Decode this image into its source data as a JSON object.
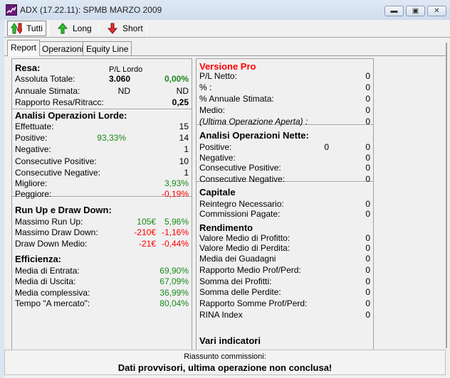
{
  "window": {
    "title": "ADX (17.22.11): SPMB MARZO 2009",
    "minimize": "minimize",
    "maximize": "maximize",
    "close": "close"
  },
  "toolbar": {
    "buttons": [
      {
        "label": "Tutti",
        "icon": "up-down-arrow-icon",
        "active": true
      },
      {
        "label": "Long",
        "icon": "up-arrow-icon"
      },
      {
        "label": "Short",
        "icon": "down-arrow-icon"
      }
    ]
  },
  "tabs": [
    {
      "label": "Report",
      "active": true
    },
    {
      "label": "Operazioni"
    },
    {
      "label": "Equity Line"
    }
  ],
  "colors": {
    "green": "#1a8a1a",
    "red": "#ff0000",
    "pro": "#ff0000"
  },
  "left": {
    "rows": [
      {
        "type": "head",
        "label": "Resa:",
        "mid": "P/L Lordo"
      },
      {
        "label": "Assoluta Totale:",
        "mid": "3.060",
        "mid_bold": true,
        "val": "0,00%",
        "val_color": "green",
        "val_bold": true
      },
      {
        "label": "Annuale Stimata:",
        "mid": "ND",
        "val": "ND"
      },
      {
        "label": "Rapporto Resa/Ritracc:",
        "val": "0,25",
        "val_bold": true
      },
      {
        "type": "head",
        "label": "Analisi Operazioni Lorde:"
      },
      {
        "label": "Effettuate:",
        "val": "15"
      },
      {
        "label": "Positive:",
        "mid": "93,33%",
        "mid_color": "green",
        "val": "14"
      },
      {
        "label": "Negative:",
        "val": "1"
      },
      {
        "label": "Consecutive Positive:",
        "val": "10"
      },
      {
        "label": "Consecutive Negative:",
        "val": "1"
      },
      {
        "label": "Migliore:",
        "val": "3,93%",
        "val_color": "green"
      },
      {
        "label": "Peggiore:",
        "val": "-0,19%",
        "val_color": "red"
      },
      {
        "type": "head",
        "label": "Run Up e Draw Down:"
      },
      {
        "label": "Massimo Run Up:",
        "mid": "105€",
        "mid_color": "green",
        "val": "5,96%",
        "val_color": "green"
      },
      {
        "label": "Massimo Draw Down:",
        "mid": "-210€",
        "mid_color": "red",
        "val": "-1,16%",
        "val_color": "red"
      },
      {
        "label": "Draw Down Medio:",
        "mid": "-21€",
        "mid_color": "red",
        "val": "-0,44%",
        "val_color": "red"
      },
      {
        "type": "head",
        "label": "Efficienza:"
      },
      {
        "label": "Media di Entrata:",
        "val": "69,90%",
        "val_color": "green"
      },
      {
        "label": "Media di Uscita:",
        "val": "67,09%",
        "val_color": "green"
      },
      {
        "label": "Media complessiva:",
        "val": "36,99%",
        "val_color": "green"
      },
      {
        "label": "Tempo \"A mercato\":",
        "val": "80,04%",
        "val_color": "green"
      }
    ]
  },
  "right": {
    "rows": [
      {
        "type": "pro",
        "label": "Versione Pro"
      },
      {
        "label": "P/L Netto:",
        "val": "0"
      },
      {
        "label": "% :",
        "val": "0"
      },
      {
        "label": "% Annuale Stimata:",
        "val": "0"
      },
      {
        "label": "Medio:",
        "val": "0"
      },
      {
        "type": "italic",
        "label": "(Ultima Operazione Aperta) :",
        "val": "0"
      },
      {
        "type": "head",
        "label": "Analisi Operazioni Nette:"
      },
      {
        "label": "Positive:",
        "mid": "0",
        "val": "0"
      },
      {
        "label": "Negative:",
        "val": "0"
      },
      {
        "label": "Consecutive Positive:",
        "val": "0"
      },
      {
        "label": "Consecutive Negative:",
        "val": "0"
      },
      {
        "type": "head",
        "label": "Capitale"
      },
      {
        "label": "Reintegro Necessario:",
        "val": "0"
      },
      {
        "label": "Commissioni Pagate:",
        "val": "0"
      },
      {
        "type": "head",
        "label": "Rendimento"
      },
      {
        "label": "Valore Medio di Profitto:",
        "val": "0"
      },
      {
        "label": "Valore Medio di Perdita:",
        "val": "0"
      },
      {
        "label": "Media dei Guadagni",
        "val": "0"
      },
      {
        "label": "Rapporto Medio Prof/Perd:",
        "val": "0"
      },
      {
        "label": "Somma dei Profitti:",
        "val": "0"
      },
      {
        "label": "Somma delle Perdite:",
        "val": "0"
      },
      {
        "label": "Rapporto Somme Prof/Perd:",
        "val": "0"
      },
      {
        "label": "RINA Index",
        "val": "0"
      },
      {
        "type": "head",
        "label": "Vari indicatori"
      }
    ]
  },
  "footer": {
    "summary_label": "Riassunto commissioni:",
    "warning": "Dati provvisori, ultima operazione non conclusa!"
  }
}
